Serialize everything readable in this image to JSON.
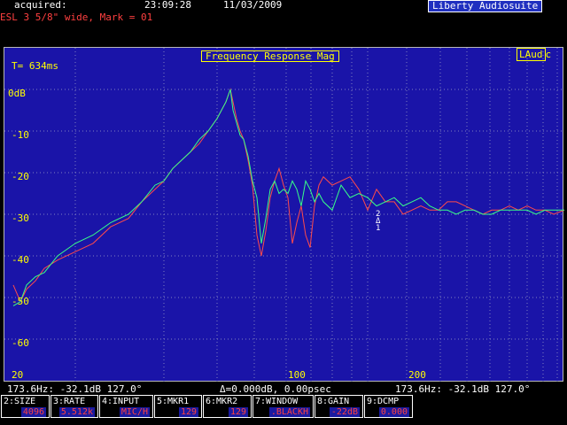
{
  "header": {
    "acquired_label": "acquired:",
    "time": "23:09:28",
    "date": "11/03/2009",
    "brand": "Liberty Audiosuite",
    "subtitle": "ESL 3 5/8\" wide, Mark = 01"
  },
  "plot": {
    "title": "Frequency Response Mag",
    "logo": "LAud",
    "logo_sub": "c",
    "time_window": "T= 634ms",
    "y_labels": [
      "0dB",
      "-10",
      "-20",
      "-30",
      "-40",
      "-50",
      "-60"
    ],
    "x_labels": [
      "20",
      "100",
      "200"
    ],
    "marker_text": [
      "2",
      "Δ",
      "1"
    ]
  },
  "chart_data": {
    "type": "line",
    "xlabel": "",
    "ylabel": "",
    "x_ticks": [
      20,
      100,
      200
    ],
    "ylim": [
      -65,
      0
    ],
    "grid": true,
    "series": [
      {
        "color": "#ff4a4a",
        "x": [
          10,
          18,
          25,
          35,
          45,
          60,
          80,
          100,
          120,
          140,
          155,
          170,
          180,
          190,
          200,
          210,
          220,
          230,
          240,
          250,
          255,
          258,
          262,
          266,
          270,
          275,
          280,
          285,
          290,
          295,
          300,
          305,
          310,
          315,
          320,
          325,
          330,
          335,
          340,
          345,
          350,
          355,
          360,
          370,
          380,
          390,
          400,
          410,
          420,
          430,
          440,
          450,
          460,
          470,
          480,
          490,
          500,
          510,
          520,
          530,
          540,
          550,
          560,
          570,
          580,
          590,
          600,
          610,
          620,
          632
        ],
        "y": [
          -47,
          -51,
          -48,
          -46,
          -43,
          -41,
          -39,
          -37,
          -33,
          -31,
          -27,
          -24,
          -22,
          -19,
          -17,
          -15,
          -13,
          -10,
          -7,
          -3,
          0,
          -3,
          -7,
          -10,
          -12,
          -17,
          -23,
          -35,
          -40,
          -34,
          -26,
          -22,
          -19,
          -23,
          -26,
          -37,
          -32,
          -28,
          -35,
          -38,
          -28,
          -23,
          -21,
          -23,
          -22,
          -21,
          -24,
          -29,
          -24,
          -27,
          -27,
          -30,
          -29,
          -28,
          -29,
          -29,
          -27,
          -27,
          -28,
          -29,
          -30,
          -29,
          -29,
          -28,
          -29,
          -28,
          -29,
          -29,
          -30,
          -29
        ]
      },
      {
        "color": "#38ff88",
        "x": [
          10,
          18,
          25,
          35,
          45,
          60,
          80,
          100,
          120,
          140,
          155,
          170,
          180,
          190,
          200,
          210,
          220,
          230,
          240,
          250,
          255,
          258,
          262,
          266,
          270,
          275,
          280,
          285,
          290,
          295,
          300,
          305,
          310,
          315,
          320,
          325,
          330,
          335,
          340,
          345,
          350,
          355,
          360,
          370,
          380,
          390,
          400,
          410,
          420,
          430,
          440,
          450,
          460,
          470,
          480,
          490,
          500,
          510,
          520,
          530,
          540,
          550,
          560,
          570,
          580,
          590,
          600,
          610,
          620,
          632
        ],
        "y": [
          -52,
          -51,
          -47,
          -45,
          -44,
          -40,
          -37,
          -35,
          -32,
          -30,
          -27,
          -23,
          -22,
          -19,
          -17,
          -15,
          -12,
          -10,
          -7,
          -3,
          0,
          -5,
          -8,
          -11,
          -12,
          -16,
          -22,
          -26,
          -37,
          -31,
          -24,
          -22,
          -25,
          -24,
          -25,
          -22,
          -24,
          -28,
          -22,
          -24,
          -27,
          -25,
          -27,
          -29,
          -23,
          -26,
          -25,
          -26,
          -28,
          -27,
          -26,
          -28,
          -27,
          -26,
          -28,
          -29,
          -29,
          -30,
          -29,
          -29,
          -30,
          -30,
          -29,
          -29,
          -29,
          -29,
          -30,
          -29,
          -29,
          -29
        ]
      }
    ]
  },
  "status": {
    "left": "173.6Hz: -32.1dB  127.0°",
    "center": "Δ=0.000dB, 0.00psec",
    "right": "173.6Hz: -32.1dB  127.0°"
  },
  "fkeys": [
    {
      "label": "2:SIZE",
      "value": "4096"
    },
    {
      "label": "3:RATE",
      "value": "5.512k"
    },
    {
      "label": "4:INPUT",
      "value": "MIC/H"
    },
    {
      "label": "5:MKR1",
      "value": "129"
    },
    {
      "label": "6:MKR2",
      "value": "129"
    },
    {
      "label": "7:WINDOW",
      "value": ".BLACKH"
    },
    {
      "label": "8:GAIN",
      "value": "-22dB"
    },
    {
      "label": "9:DCMP",
      "value": "0.000"
    }
  ]
}
